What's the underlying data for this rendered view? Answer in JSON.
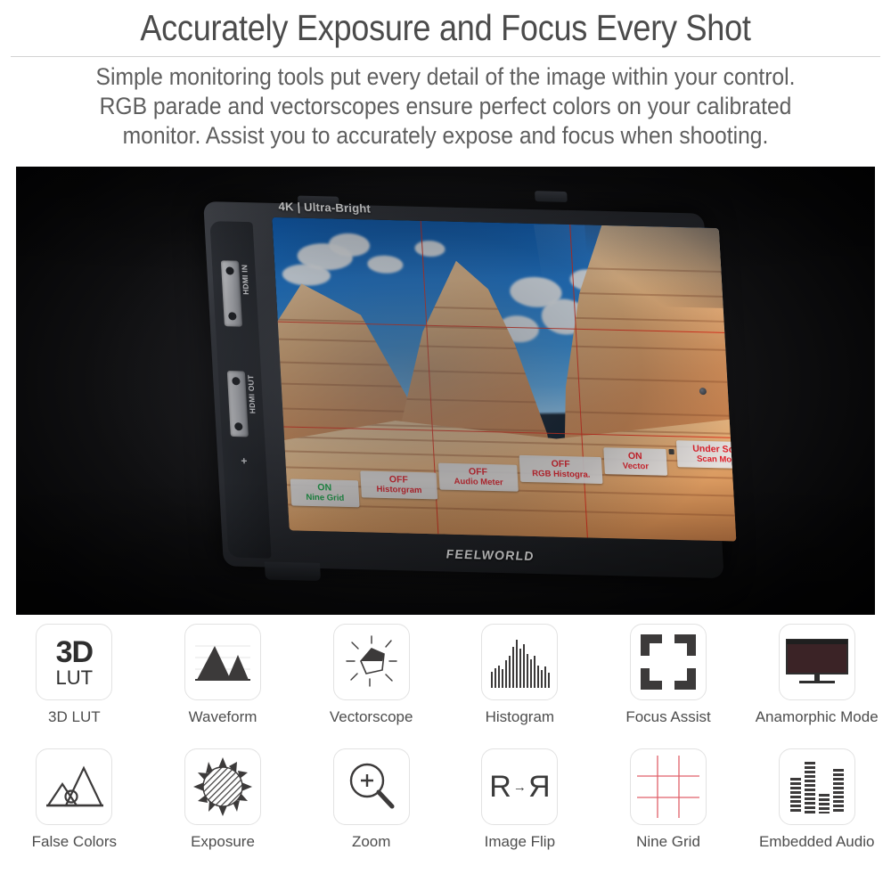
{
  "header": {
    "title": "Accurately Exposure and Focus Every Shot",
    "subtitle_line1": "Simple monitoring tools put every detail of the image within your control.",
    "subtitle_line2": "RGB parade and vectorscopes ensure perfect colors on your calibrated",
    "subtitle_line3": "monitor. Assist you to accurately expose and focus when shooting.",
    "title_color": "#4b4b4b",
    "subtitle_color": "#5e5e5e",
    "divider_color": "#d3d3d3"
  },
  "product": {
    "screen_badge": "4K | Ultra-Bright",
    "brand": "FEELWORLD",
    "ports": [
      {
        "label": "HDMI IN"
      },
      {
        "label": "HDMI OUT"
      }
    ],
    "plus_mark": "+",
    "osd_buttons": [
      {
        "value": "ON",
        "name": "Nine Grid",
        "value_color": "#1ba54a",
        "name_color": "#1ba54a"
      },
      {
        "value": "OFF",
        "name": "Historgram",
        "value_color": "#e0202a",
        "name_color": "#e0202a"
      },
      {
        "value": "OFF",
        "name": "Audio Meter",
        "value_color": "#e0202a",
        "name_color": "#e0202a"
      },
      {
        "value": "OFF",
        "name": "RGB Histogra.",
        "value_color": "#e0202a",
        "name_color": "#e0202a"
      },
      {
        "value": "ON",
        "name": "Vector",
        "value_color": "#e0202a",
        "name_color": "#e0202a"
      },
      {
        "value": "Under Scan",
        "name": "Scan Mode",
        "value_color": "#e0202a",
        "name_color": "#e0202a"
      }
    ],
    "grid_color": "#e02b18"
  },
  "features": {
    "row1": [
      {
        "label": "3D LUT",
        "icon": "3d-lut-icon",
        "text_top": "3D",
        "text_bottom": "LUT"
      },
      {
        "label": "Waveform",
        "icon": "waveform-icon"
      },
      {
        "label": "Vectorscope",
        "icon": "vectorscope-icon"
      },
      {
        "label": "Histogram",
        "icon": "histogram-icon"
      },
      {
        "label": "Focus Assist",
        "icon": "focus-assist-icon"
      },
      {
        "label": "Anamorphic Mode",
        "icon": "anamorphic-mode-icon"
      }
    ],
    "row2": [
      {
        "label": "False Colors",
        "icon": "false-colors-icon"
      },
      {
        "label": "Exposure",
        "icon": "exposure-sun-icon"
      },
      {
        "label": "Zoom",
        "icon": "zoom-magnifier-icon"
      },
      {
        "label": "Image Flip",
        "icon": "image-flip-icon",
        "text_left": "R",
        "text_arrow": "→",
        "text_right": "R"
      },
      {
        "label": "Nine Grid",
        "icon": "nine-grid-icon"
      },
      {
        "label": "Embedded Audio",
        "icon": "embedded-audio-icon"
      }
    ],
    "icon_color": "#3c3a3a",
    "box_border": "#e2e2e2",
    "label_color": "#4d4d4d",
    "grid_line_color": "#e0606a"
  }
}
